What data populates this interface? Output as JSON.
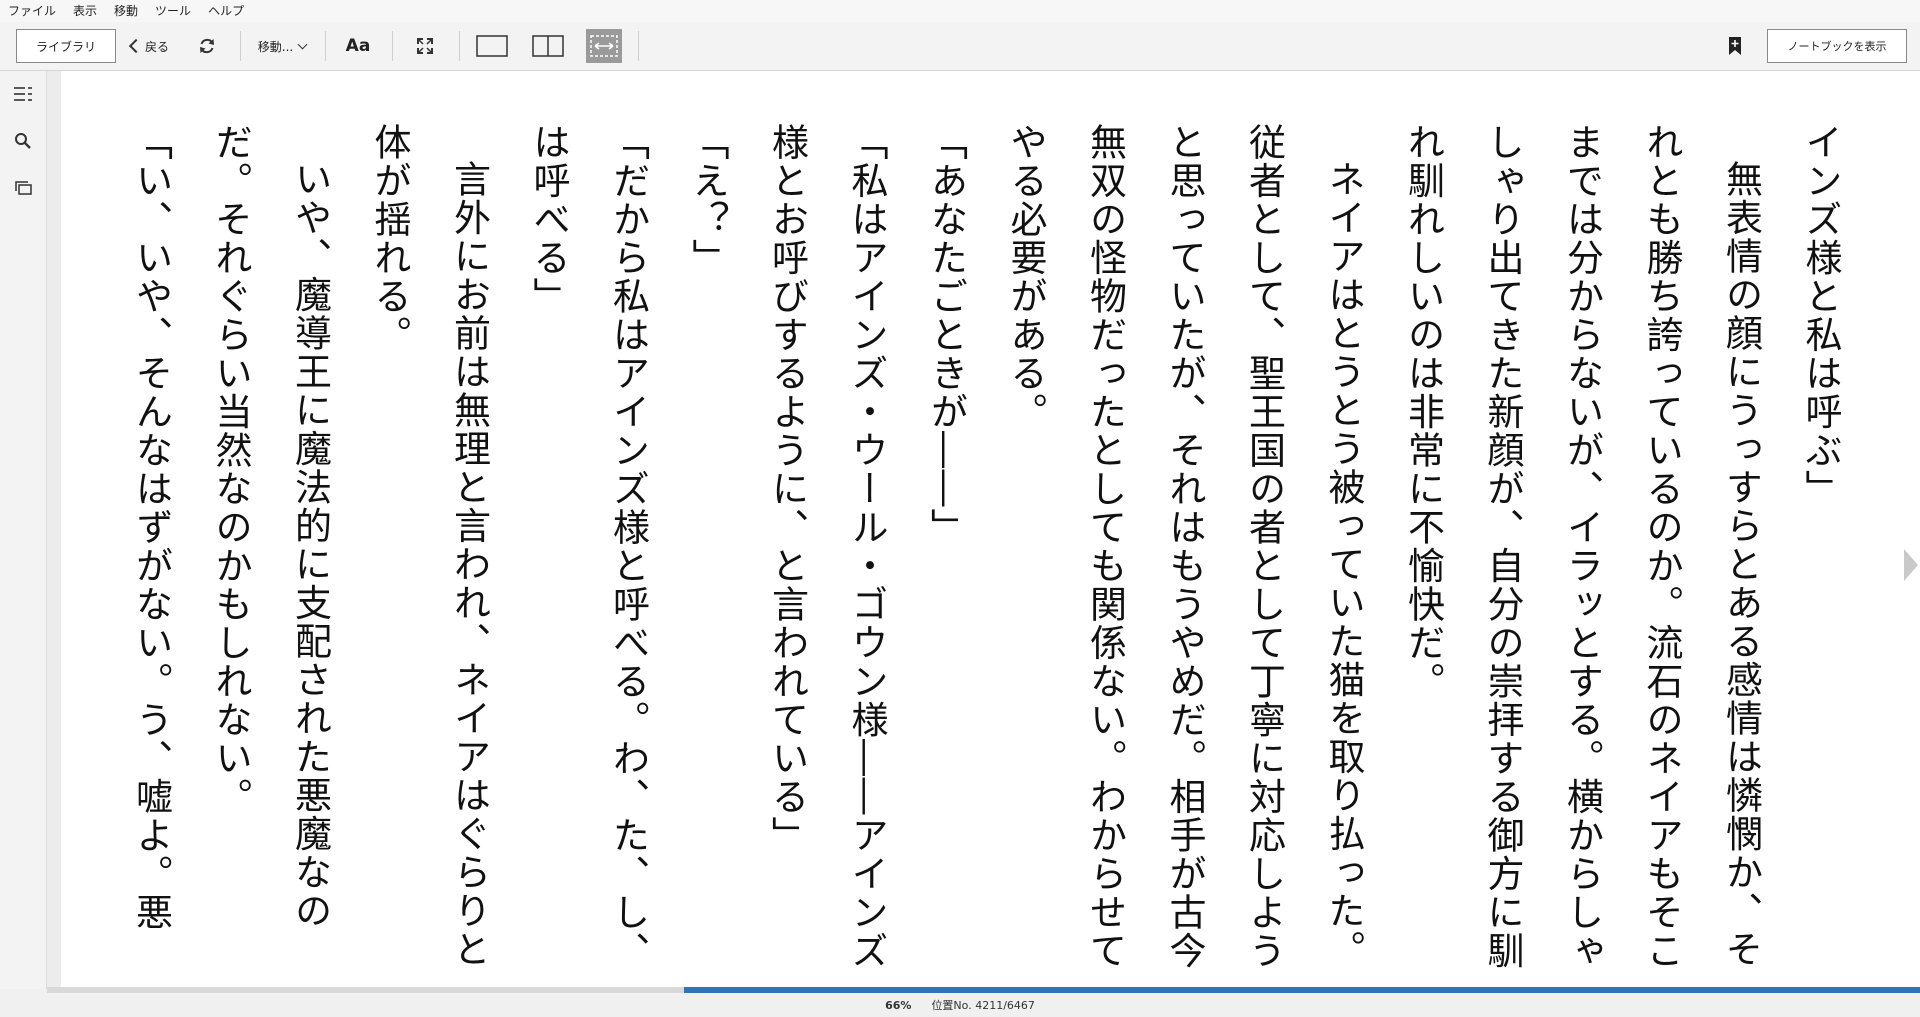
{
  "menu": [
    "ファイル",
    "表示",
    "移動",
    "ツール",
    "ヘルプ"
  ],
  "toolbar": {
    "library_label": "ライブラリ",
    "back_label": "戻る",
    "goto_label": "移動...",
    "font_label": "Aa",
    "notebook_label": "ノートブックを表示"
  },
  "content": [
    {
      "text": "インズ様と私は呼ぶ」",
      "indent": false
    },
    {
      "text": "無表情の顔にうっすらとある感情は憐憫か、それとも勝ち誇っているのか。流石のネイアもそこまでは分からないが、イラッとする。横からしゃしゃり出てきた新顔が、自分の崇拝する御方に馴れ馴れしいのは非常に不愉快だ。",
      "indent": true
    },
    {
      "text": "ネイアはとうとう被っていた猫を取り払った。従者として、聖王国の者として丁寧に対応しようと思っていたが、それはもうやめだ。相手が古今無双の怪物だったとしても関係ない。わからせてやる必要がある。",
      "indent": true
    },
    {
      "text": "「あなたごときが――」",
      "indent": false
    },
    {
      "text": "「私はアインズ・ウール・ゴウン様――アインズ様とお呼びするように、と言われている」",
      "indent": false
    },
    {
      "text": "「え？」",
      "indent": false
    },
    {
      "text": "「だから私はアインズ様と呼べる。わ、た、し、は呼べる」",
      "indent": false
    },
    {
      "text": "言外にお前は無理と言われ、ネイアはぐらりと体が揺れる。",
      "indent": true
    },
    {
      "text": "いや、魔導王に魔法的に支配された悪魔なのだ。それぐらい当然なのかもしれない。",
      "indent": true
    },
    {
      "text": "「い、いや、そんなはずがない。う、嘘よ。悪",
      "indent": false
    }
  ],
  "status": {
    "percent": "66%",
    "location": "位置No. 4211/6467",
    "progress": 0.66
  },
  "colors": {
    "progress": "#2f74b6"
  }
}
